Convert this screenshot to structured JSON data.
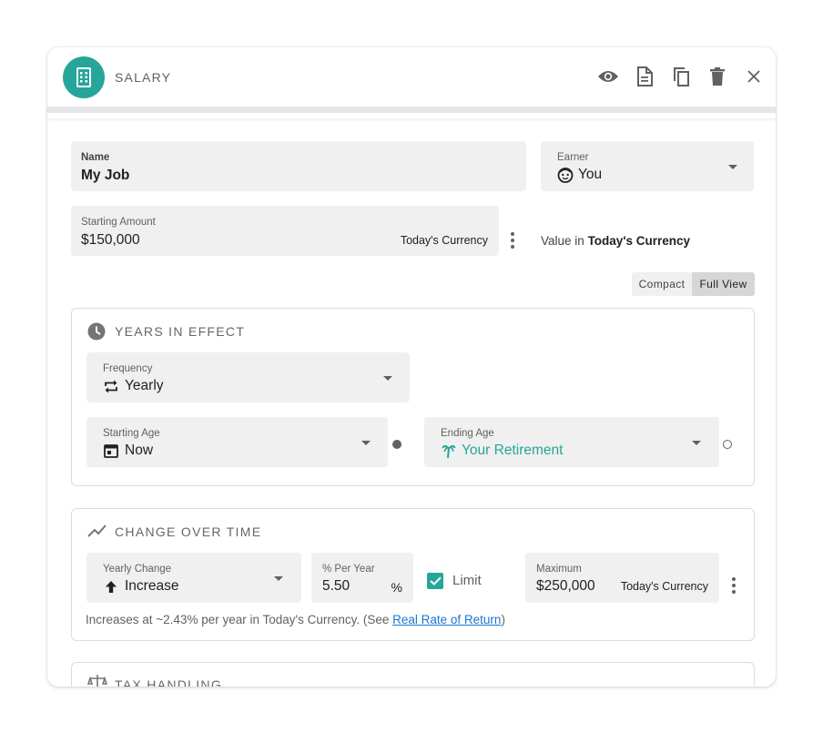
{
  "header": {
    "title": "SALARY",
    "avatar_icon": "building-icon",
    "accent_color": "#26a69a",
    "actions": [
      "eye-icon",
      "document-icon",
      "copy-icon",
      "trash-icon",
      "close-icon"
    ]
  },
  "name_field": {
    "label": "Name",
    "value": "My Job"
  },
  "earner_field": {
    "label": "Earner",
    "value": "You",
    "icon": "face-icon"
  },
  "amount_field": {
    "label": "Starting Amount",
    "value": "$150,000",
    "currency": "Today's Currency"
  },
  "value_in": {
    "prefix": "Value in",
    "currency": "Today's Currency"
  },
  "view_toggle": {
    "compact": "Compact",
    "full": "Full View",
    "selected": "Full View"
  },
  "years_section": {
    "title": "YEARS IN EFFECT",
    "frequency": {
      "label": "Frequency",
      "value": "Yearly"
    },
    "starting_age": {
      "label": "Starting Age",
      "value": "Now"
    },
    "ending_age": {
      "label": "Ending Age",
      "value": "Your Retirement"
    }
  },
  "change_section": {
    "title": "CHANGE OVER TIME",
    "yearly_change": {
      "label": "Yearly Change",
      "value": "Increase"
    },
    "per_year": {
      "label": "% Per Year",
      "value": "5.50",
      "unit": "%"
    },
    "limit": {
      "label": "Limit",
      "checked": true
    },
    "maximum": {
      "label": "Maximum",
      "value": "$250,000",
      "currency": "Today's Currency"
    },
    "note_text": "Increases at ~2.43% per year in Today's Currency. (See ",
    "note_link": "Real Rate of Return",
    "note_end": ")"
  },
  "tax_section": {
    "title": "TAX HANDLING"
  }
}
